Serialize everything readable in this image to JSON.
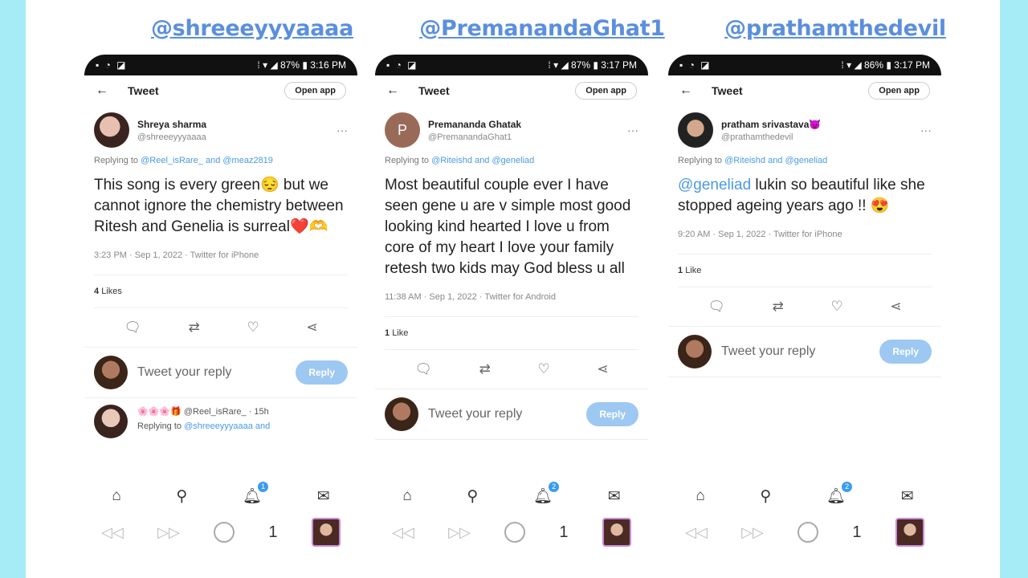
{
  "handles": [
    "@shreeeyyyaaaa",
    "@PremanandaGhat1",
    "@prathamthedevil"
  ],
  "common": {
    "status_left": "▪ ◔ ◪",
    "tweet_title": "Tweet",
    "open_app": "Open app",
    "reply_placeholder": "Tweet your reply",
    "reply_button": "Reply"
  },
  "phones": [
    {
      "status_right": "⁞ ▾ ◢ 87% ▮ 3:16 PM",
      "display_name": "Shreya sharma",
      "username": "@shreeeyyyaaaa",
      "replying_prefix": "Replying to",
      "replying_to": "@Reel_isRare_ and @meaz2819",
      "tweet_text": "This song is every green😔 but we cannot ignore the chemistry between Ritesh and Genelia is surreal❤️🫶",
      "meta": "3:23 PM · Sep 1, 2022 · Twitter for iPhone",
      "likes_count": "4",
      "likes_label": "Likes",
      "sub_reply_header": "🌸🌸🌸🎁 @Reel_isRare_ · 15h",
      "sub_reply_prefix": "Replying to",
      "sub_reply_to": "@shreeeyyyaaaa and",
      "notif_count": "1",
      "tab_count": "1"
    },
    {
      "status_right": "⁞ ▾ ◢ 87% ▮ 3:17 PM",
      "avatar_letter": "P",
      "display_name": "Premananda Ghatak",
      "username": "@PremanandaGhat1",
      "replying_prefix": "Replying to",
      "replying_to": "@Riteishd and @geneliad",
      "tweet_text": "Most beautiful couple ever I have seen gene u are v simple most good looking kind hearted I love u from core of my heart I love your family retesh two kids may God bless u all",
      "meta": "11:38 AM · Sep 1, 2022 · Twitter for Android",
      "likes_count": "1",
      "likes_label": "Like",
      "notif_count": "2",
      "tab_count": "1"
    },
    {
      "status_right": "⁞ ▾ ◢ 86% ▮ 3:17 PM",
      "display_name": "pratham srivastava😈",
      "username": "@prathamthedevil",
      "replying_prefix": "Replying to",
      "replying_to": "@Riteishd and @geneliad",
      "tweet_mention": "@geneliad",
      "tweet_text": "lukin so beautiful like she stopped ageing years ago !! 😍",
      "meta": "9:20 AM · Sep 1, 2022 · Twitter for iPhone",
      "likes_count": "1",
      "likes_label": "Like",
      "notif_count": "2",
      "tab_count": "1"
    }
  ],
  "icons": {
    "back": "back-arrow-icon",
    "reply": "reply-icon",
    "retweet": "retweet-icon",
    "like": "heart-icon",
    "share": "share-icon",
    "home": "home-icon",
    "search": "search-icon",
    "notifications": "bell-icon",
    "messages": "mail-icon"
  }
}
